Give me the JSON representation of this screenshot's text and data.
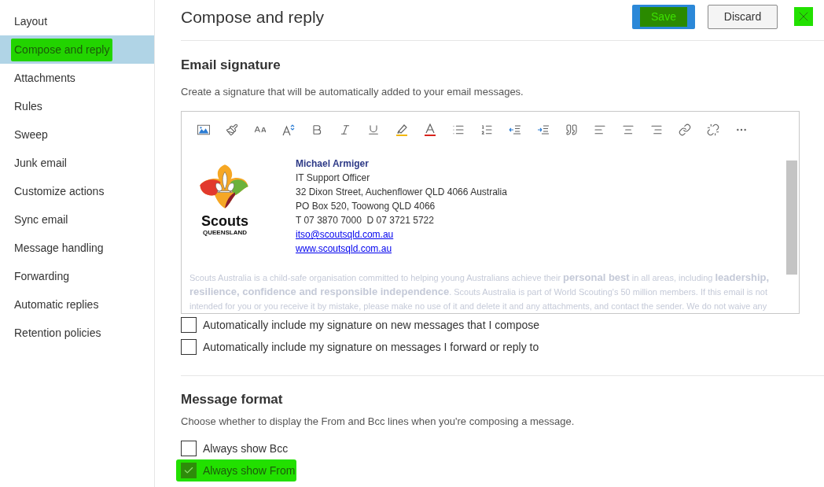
{
  "sidebar": {
    "items": [
      {
        "label": "Layout",
        "selected": false,
        "highlighted": false
      },
      {
        "label": "Compose and reply",
        "selected": true,
        "highlighted": true
      },
      {
        "label": "Attachments",
        "selected": false,
        "highlighted": false
      },
      {
        "label": "Rules",
        "selected": false,
        "highlighted": false
      },
      {
        "label": "Sweep",
        "selected": false,
        "highlighted": false
      },
      {
        "label": "Junk email",
        "selected": false,
        "highlighted": false
      },
      {
        "label": "Customize actions",
        "selected": false,
        "highlighted": false
      },
      {
        "label": "Sync email",
        "selected": false,
        "highlighted": false
      },
      {
        "label": "Message handling",
        "selected": false,
        "highlighted": false
      },
      {
        "label": "Forwarding",
        "selected": false,
        "highlighted": false
      },
      {
        "label": "Automatic replies",
        "selected": false,
        "highlighted": false
      },
      {
        "label": "Retention policies",
        "selected": false,
        "highlighted": false
      }
    ]
  },
  "header": {
    "title": "Compose and reply",
    "buttons": [
      {
        "label": "Save",
        "kind": "primary",
        "highlighted": true
      },
      {
        "label": "Discard",
        "kind": "secondary",
        "highlighted": false
      }
    ],
    "close": {
      "highlighted": true
    }
  },
  "email_signature": {
    "heading": "Email signature",
    "description": "Create a signature that will be automatically added to your email messages.",
    "editor": {
      "logo": {
        "wordmark": "Scouts",
        "subtitle": "QUEENSLAND"
      },
      "lines": [
        {
          "text": "Michael Armiger",
          "kind": "name"
        },
        {
          "text": "IT Support Officer",
          "kind": "plain"
        },
        {
          "text": "32 Dixon Street, Auchenflower QLD 4066 Australia",
          "kind": "plain"
        },
        {
          "text": "PO Box 520, Toowong QLD 4066",
          "kind": "plain"
        },
        {
          "text": "T 07 3870 7000  D 07 3721 5722",
          "kind": "plain"
        },
        {
          "text": "itso@scoutsqld.com.au",
          "kind": "link"
        },
        {
          "text": "www.scoutsqld.com.au",
          "kind": "link"
        }
      ],
      "disclaimer": "Scouts Australia is a child-safe organisation committed to helping young Australians achieve their **personal best** in all areas, including **leadership, resilience, confidence and responsible independence**. Scouts Australia is part of World Scouting's 50 million members. If this email is not intended for you or you receive it by mistake, please make no use of it and delete it and any attachments, and contact the sender. We do not waive any"
    },
    "options": [
      {
        "label": "Automatically include my signature on new messages that I compose",
        "checked": false,
        "highlighted": false
      },
      {
        "label": "Automatically include my signature on messages I forward or reply to",
        "checked": false,
        "highlighted": false
      }
    ]
  },
  "message_format": {
    "heading": "Message format",
    "description": "Choose whether to display the From and Bcc lines when you're composing a message.",
    "options": [
      {
        "label": "Always show Bcc",
        "checked": false,
        "highlighted": false
      },
      {
        "label": "Always show From",
        "checked": true,
        "highlighted": true
      }
    ]
  }
}
